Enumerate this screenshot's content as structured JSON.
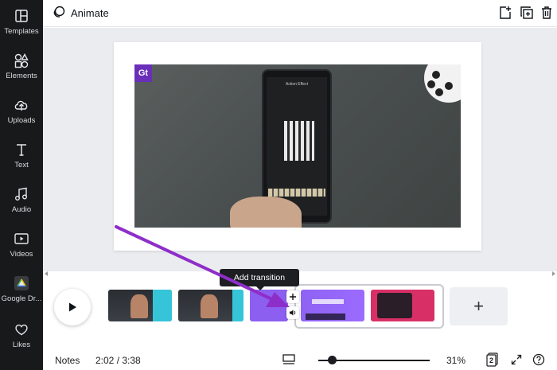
{
  "sidebar": {
    "items": [
      {
        "label": "Templates",
        "icon": "templates-icon"
      },
      {
        "label": "Elements",
        "icon": "elements-icon"
      },
      {
        "label": "Uploads",
        "icon": "uploads-icon"
      },
      {
        "label": "Text",
        "icon": "text-icon"
      },
      {
        "label": "Audio",
        "icon": "audio-icon"
      },
      {
        "label": "Videos",
        "icon": "videos-icon"
      },
      {
        "label": "Google Dr...",
        "icon": "google-drive-icon"
      },
      {
        "label": "Likes",
        "icon": "heart-icon"
      }
    ]
  },
  "topbar": {
    "animate_label": "Animate",
    "tools": [
      "add-page-icon",
      "duplicate-page-icon",
      "delete-icon"
    ]
  },
  "canvas": {
    "logo_text": "Gt",
    "phone_title": "Action Effect"
  },
  "timeline": {
    "tooltip": "Add transition",
    "add_label": "+",
    "transition_icon": "+"
  },
  "bottombar": {
    "notes_label": "Notes",
    "time": "2:02 / 3:38",
    "zoom": "31%",
    "zoom_fraction": 0.31,
    "page_count": "2"
  },
  "colors": {
    "sidebar_bg": "#18191b",
    "accent_purple": "#8c5ff0",
    "arrow": "#8e2ec9"
  }
}
